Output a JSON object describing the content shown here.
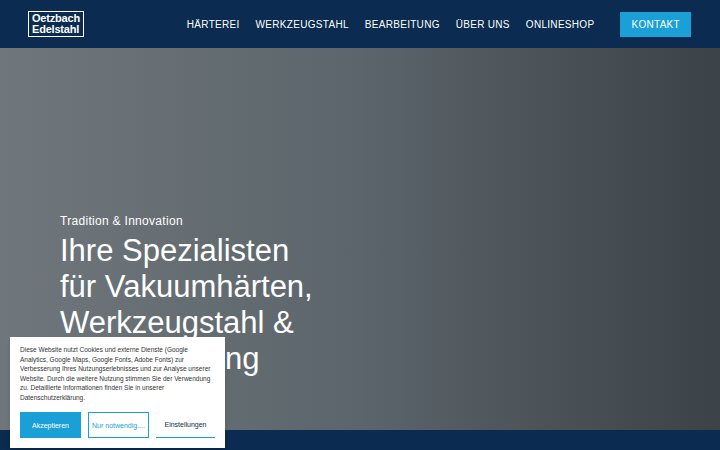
{
  "logo": {
    "line1": "Oetzbach",
    "line2": "Edelstahl"
  },
  "nav": {
    "items": [
      {
        "label": "HÄRTEREI"
      },
      {
        "label": "WERKZEUGSTAHL"
      },
      {
        "label": "BEARBEITUNG"
      },
      {
        "label": "ÜBER UNS"
      },
      {
        "label": "ONLINESHOP"
      }
    ],
    "cta": "KONTAKT"
  },
  "hero": {
    "eyebrow": "Tradition & Innovation",
    "headline": [
      "Ihre Spezialisten",
      "für Vakuumhärten,",
      "Werkzeugstahl &",
      "ng"
    ]
  },
  "cookie": {
    "text": "Diese Website nutzt Cookies und externe Dienste (Google Analytics, Google Maps, Google Fonts, Adobe Fonts) zur Verbesserung Ihres Nutzungserlebnisses und zur Analyse unserer Website. Durch die weitere Nutzung stimmen Sie der Verwendung zu. Detaillierte Informationen finden Sie in unserer Datenschutzerklärung.",
    "buttons": [
      {
        "label": "Akzeptieren",
        "kind": "primary"
      },
      {
        "label": "Nur notwendig....",
        "kind": "outline"
      },
      {
        "label": "Einstellungen",
        "kind": "link"
      }
    ]
  }
}
